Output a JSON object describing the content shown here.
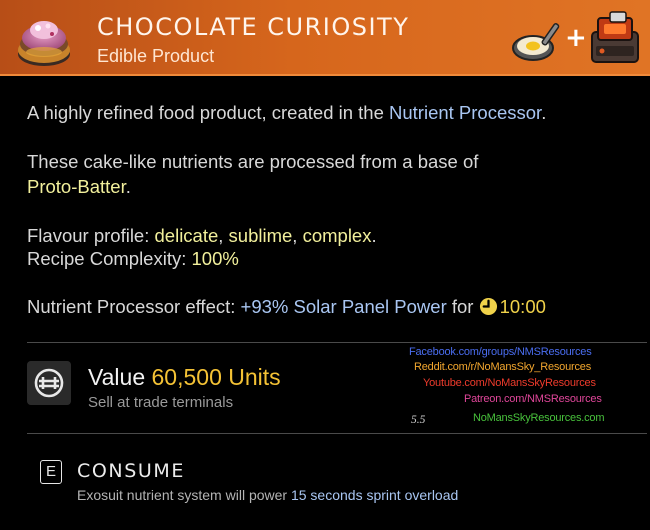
{
  "header": {
    "title": "CHOCOLATE CURIOSITY",
    "subtitle": "Edible Product",
    "item_icon": "cake-icon",
    "recipe": {
      "ingredient_icon": "frying-pan-icon",
      "plus": "+",
      "device_icon": "nutrient-processor-icon"
    }
  },
  "description": {
    "line1_prefix": "A highly refined food product, created in the ",
    "line1_link": "Nutrient Processor",
    "line1_suffix": ".",
    "line2_prefix": "These cake-like nutrients are processed from a base of",
    "line2_link": "Proto-Batter",
    "line2_suffix": "."
  },
  "flavour": {
    "label": "Flavour profile: ",
    "values": [
      "delicate",
      "sublime",
      "complex"
    ],
    "sep": ", ",
    "end": ".",
    "complexity_label": "Recipe Complexity: ",
    "complexity_value": "100%"
  },
  "effect": {
    "label": "Nutrient Processor effect: ",
    "value": "+93% Solar Panel Power",
    "for": " for ",
    "clock_icon": "clock-icon",
    "duration": "10:00"
  },
  "value": {
    "icon": "units-currency-icon",
    "label": "Value ",
    "amount": "60,500 Units",
    "sub": "Sell at trade terminals"
  },
  "watermark": {
    "lines": [
      {
        "text": "Facebook.com/groups/NMSResources",
        "color": "#4a6df0"
      },
      {
        "text": "Reddit.com/r/NoMansSky_Resources",
        "color": "#f2a62e"
      },
      {
        "text": "Youtube.com/NoMansSkyResources",
        "color": "#ef3b2c"
      },
      {
        "text": "Patreon.com/NMSResources",
        "color": "#e0469a"
      },
      {
        "text": "NoMansSkyResources.com",
        "color": "#48c23c"
      }
    ],
    "version": "5.5"
  },
  "consume": {
    "key": "E",
    "label": "CONSUME",
    "desc_prefix": "Exosuit nutrient system will power ",
    "desc_highlight": "15 seconds sprint overload"
  },
  "colors": {
    "header_orange": "#d6661c",
    "link_blue": "#a9c6f2",
    "keyword_yellow": "#f2f09c",
    "value_gold": "#f4c235"
  }
}
